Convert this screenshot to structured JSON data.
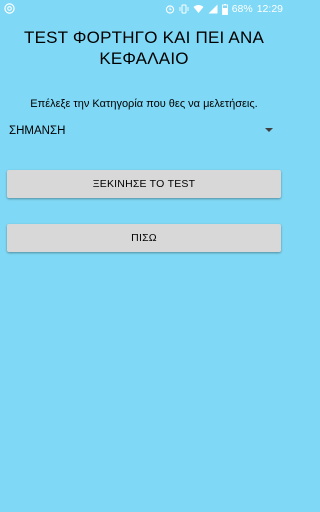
{
  "status_bar": {
    "battery_text": "68%",
    "time": "12:29",
    "icons": [
      "app-notification-icon",
      "alarm-icon",
      "vibrate-icon",
      "wifi-icon",
      "signal-icon",
      "battery-icon"
    ]
  },
  "title_lines": [
    "TEST ΦΟΡΤΗΓΟ ΚΑΙ ΠΕΙ ΑΝΑ",
    "ΚΕΦΑΛΑΙΟ"
  ],
  "prompt": "Επέλεξε την Κατηγορία που θες να μελετήσεις.",
  "category_select": {
    "selected": "ΣΗΜΑΝΣΗ",
    "icon": "dropdown-arrow-icon"
  },
  "buttons": {
    "start_label": "ΞΕΚΙΝΗΣΕ ΤΟ TEST",
    "back_label": "ΠΙΣΩ"
  },
  "colors": {
    "background": "#7fd8f5",
    "button": "#d8d8d8",
    "status_icons": "#ffffff"
  }
}
